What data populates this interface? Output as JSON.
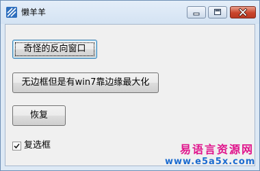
{
  "window": {
    "title": "懒羊羊"
  },
  "buttons": {
    "reverse_window": "奇怪的反向窗口",
    "borderless_maximize": "无边框但是有win7靠边缘最大化",
    "restore": "恢复"
  },
  "checkbox": {
    "label": "复选框",
    "checked": true
  },
  "watermark": {
    "title": "易语言资源网",
    "url": "www.e5a5x.com"
  },
  "icons": {
    "app": "app-icon",
    "minimize": "minimize-icon",
    "maximize": "maximize-icon",
    "close": "close-icon",
    "check": "check-icon"
  },
  "colors": {
    "titlebar": "#dde9f5",
    "client": "#f0f0f0",
    "close_button": "#c9452b",
    "watermark_title": "#e0148c",
    "watermark_url": "#1b6bd0"
  }
}
